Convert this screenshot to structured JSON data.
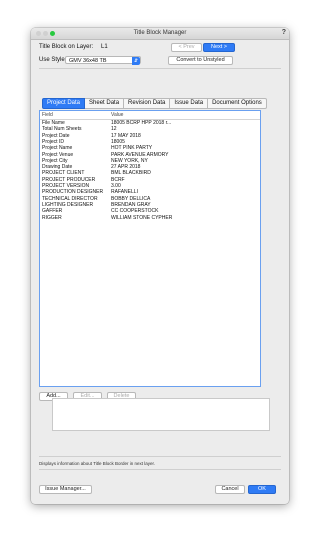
{
  "window": {
    "title": "Title Block Manager",
    "help_label": "?"
  },
  "header": {
    "layer_label": "Title Block on Layer:",
    "layer_value": "L1",
    "prev_label": "< Prev",
    "next_label": "Next >",
    "style_label": "Use Style:",
    "style_value": "GMV 36x48 TB",
    "convert_label": "Convert to Unstyled"
  },
  "tabs": [
    {
      "label": "Project Data",
      "active": true
    },
    {
      "label": "Sheet Data"
    },
    {
      "label": "Revision Data"
    },
    {
      "label": "Issue Data"
    },
    {
      "label": "Document Options"
    }
  ],
  "table": {
    "headers": [
      "Field",
      "Value"
    ],
    "rows": [
      [
        "File Name",
        "18005 BCRP HPP 2018 r..."
      ],
      [
        "Total Num Sheets",
        "12"
      ],
      [
        "Project Date",
        "17 MAY 2018"
      ],
      [
        "Project ID",
        "18005"
      ],
      [
        "Project Name",
        "HOT PINK PARTY"
      ],
      [
        "Project Venue",
        "PARK AVENUE ARMORY"
      ],
      [
        "Project City",
        "NEW YORK, NY"
      ],
      [
        "Drawing Date",
        "27 APR 2018"
      ],
      [
        "PROJECT CLIENT",
        "BML BLACKBIRD"
      ],
      [
        "PROJECT PRODUCER",
        "BCRF"
      ],
      [
        "PROJECT VERSION",
        "3.00"
      ],
      [
        "PRODUCTION DESIGNER",
        "RAFANELLI"
      ],
      [
        "TECHNICAL DIRECTOR",
        "BOBBY DELLICA"
      ],
      [
        "LIGHTING DESIGNER",
        "BRENDAN GRAY"
      ],
      [
        "GAFFER",
        "CC COOPERSTOCK"
      ],
      [
        "RIGGER",
        "WILLIAM STONE CYPHER"
      ]
    ]
  },
  "actions": {
    "add_label": "Add...",
    "edit_label": "Edit...",
    "delete_label": "Delete"
  },
  "status_text": "Displays information about Title Block Border in next layer.",
  "footer": {
    "issue_manager_label": "Issue Manager...",
    "cancel_label": "Cancel",
    "ok_label": "OK"
  }
}
